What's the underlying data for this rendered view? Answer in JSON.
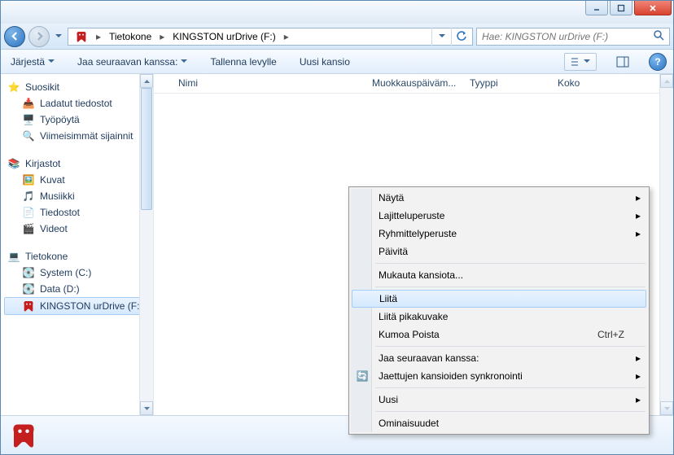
{
  "breadcrumb": {
    "seg1": "Tietokone",
    "seg2": "KINGSTON urDrive (F:)"
  },
  "search": {
    "placeholder": "Hae: KINGSTON urDrive (F:)"
  },
  "toolbar": {
    "organize": "Järjestä",
    "share": "Jaa seuraavan kanssa:",
    "save_disk": "Tallenna levylle",
    "new_folder": "Uusi kansio"
  },
  "tree": {
    "favorites": "Suosikit",
    "downloads": "Ladatut tiedostot",
    "desktop": "Työpöytä",
    "recent": "Viimeisimmät sijainnit",
    "libraries": "Kirjastot",
    "pictures": "Kuvat",
    "music": "Musiikki",
    "documents": "Tiedostot",
    "videos": "Videot",
    "computer": "Tietokone",
    "system_c": "System (C:)",
    "data_d": "Data (D:)",
    "kingston": "KINGSTON urDrive (F:)"
  },
  "columns": {
    "name": "Nimi",
    "modified": "Muokkauspäiväm...",
    "type": "Tyyppi",
    "size": "Koko"
  },
  "context": {
    "view": "Näytä",
    "sort": "Lajitteluperuste",
    "group": "Ryhmittelyperuste",
    "refresh": "Päivitä",
    "customize": "Mukauta kansiota...",
    "paste": "Liitä",
    "paste_shortcut": "Liitä pikakuvake",
    "undo": "Kumoa Poista",
    "undo_key": "Ctrl+Z",
    "share_with": "Jaa seuraavan kanssa:",
    "sync": "Jaettujen kansioiden synkronointi",
    "new": "Uusi",
    "properties": "Ominaisuudet"
  }
}
